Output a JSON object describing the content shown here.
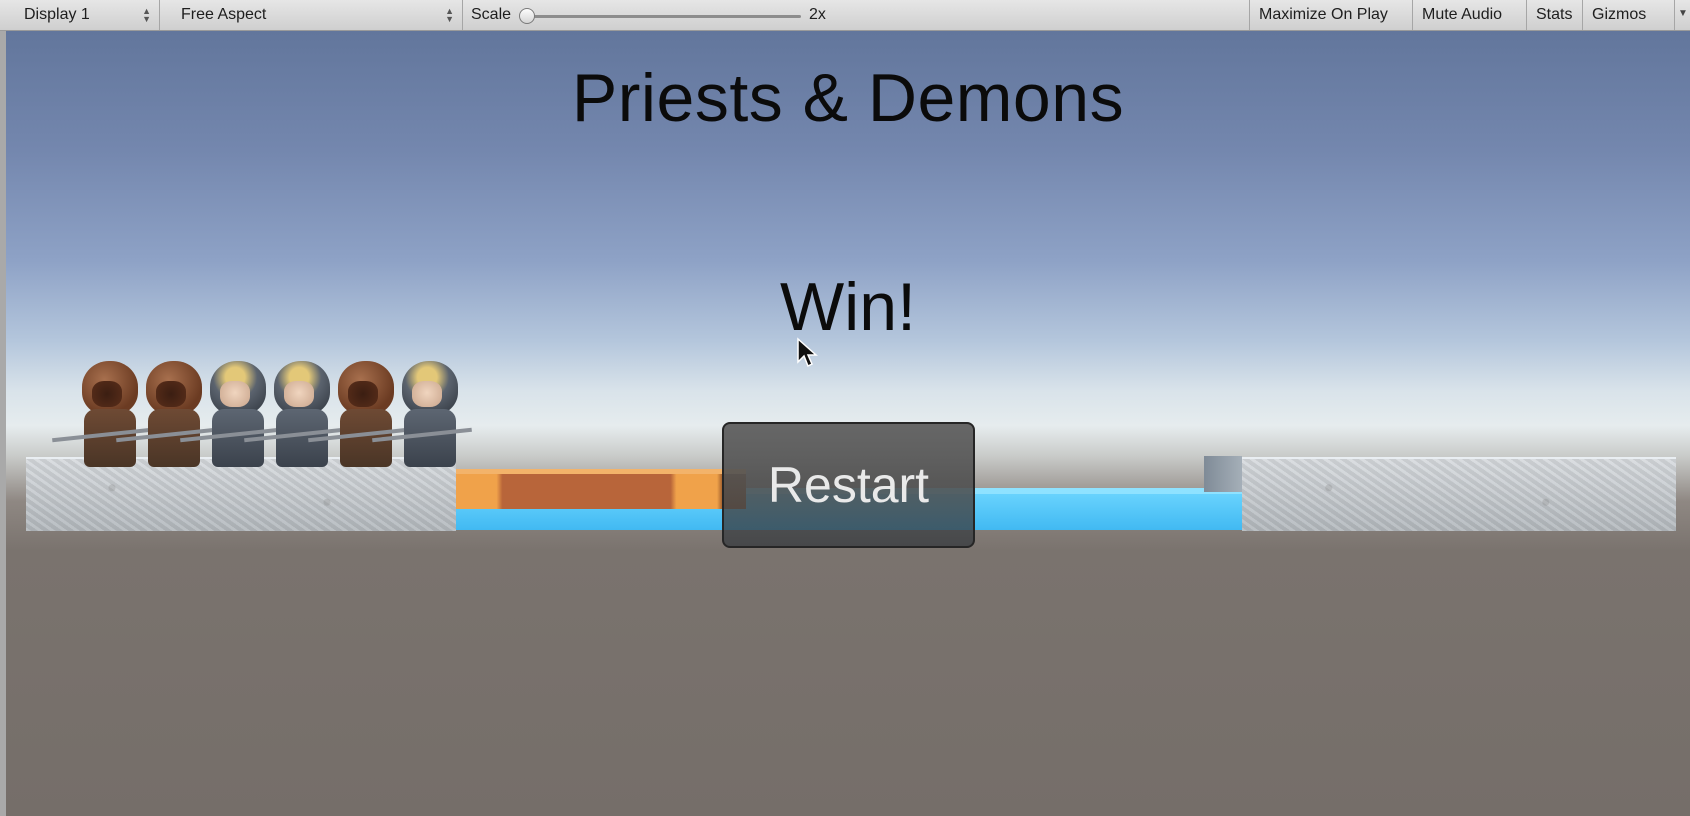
{
  "toolbar": {
    "display": "Display 1",
    "aspect": "Free Aspect",
    "scale_label": "Scale",
    "scale_value": "2x",
    "scale_slider_fraction": 0.0,
    "maximize_on_play": "Maximize On Play",
    "mute_audio": "Mute Audio",
    "stats": "Stats",
    "gizmos": "Gizmos"
  },
  "game": {
    "title": "Priests & Demons",
    "status": "Win!",
    "restart_label": "Restart",
    "left_bank_characters": [
      "demon",
      "demon",
      "priest",
      "priest",
      "demon",
      "priest"
    ]
  },
  "colors": {
    "water": "#4cc3f5",
    "boat": "#f0a24a",
    "text": "#0b0b0b",
    "button_text": "#e9e9e9"
  }
}
